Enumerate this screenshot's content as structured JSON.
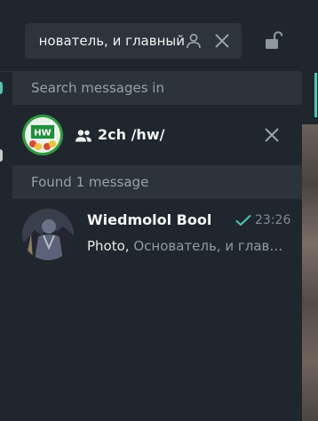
{
  "search": {
    "query": "нователь, и главный"
  },
  "icons": {
    "person": "person-icon",
    "clear": "close-icon",
    "lock": "lock-open-icon",
    "group": "group-icon",
    "check": "check-icon"
  },
  "sections": {
    "search_in": "Search messages in",
    "found": "Found 1 message"
  },
  "chat": {
    "avatar_text": "HW",
    "name": "2ch /hw/"
  },
  "result": {
    "sender": "Wiedmolol Bool",
    "time": "23:26",
    "kind": "Photo,",
    "text": "Основатель, и главный"
  },
  "colors": {
    "accent": "#4ec5b6",
    "panel_bg": "#20262d",
    "header_bg": "#2c333b",
    "search_bg": "#2d343c",
    "muted_text": "#98a1aa"
  }
}
